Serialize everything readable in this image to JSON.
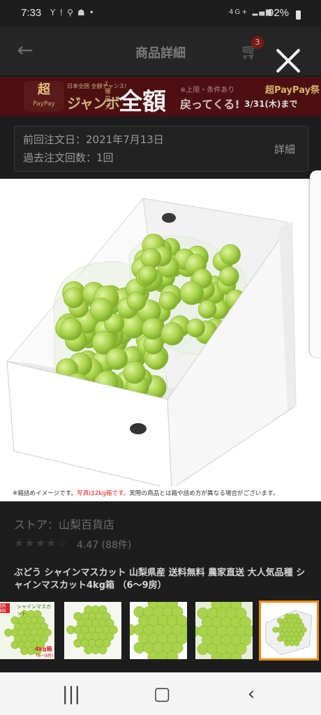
{
  "status_bar": {
    "time": "7:33",
    "battery": "92%",
    "network": "4G+"
  },
  "header": {
    "title": "商品詳細",
    "cart_count": "3"
  },
  "banner": {
    "tag": "超",
    "brand": "日本全国 全額チャンス!",
    "headline": "ジャンボ",
    "max_label": "1等最大",
    "amount": "全額",
    "note": "※上限・条件あり",
    "returns": "戻ってくる!",
    "festival": "超PayPay祭",
    "date": "3/31(木)まで"
  },
  "order_info": {
    "last_order": "前回注文日：2021年7月13日",
    "order_count": "過去注文回数：1回",
    "details_label": "詳細"
  },
  "image": {
    "caption_prefix": "※箱詰めイメージです。",
    "caption_red": "写真は2kg箱です。",
    "caption_suffix": "実際の商品とは箱や詰め方が異なる場合がございます。"
  },
  "store": {
    "label": "ストア：山梨百貨店",
    "stars": "★★★★☆",
    "rating": "4.47",
    "reviews": "(88件)"
  },
  "product": {
    "title": "ぶどう シャインマスカット 山梨県産 送料無料 農家直送 大人気品種 シャインマスカット4kg箱 （6〜9房）"
  },
  "thumbnails": [
    {
      "label": "4kg箱",
      "sub": "(6〜9房)",
      "badge": "送料無料",
      "top_text": "シャインマスカット"
    },
    {
      "label": ""
    },
    {
      "label": ""
    },
    {
      "label": ""
    },
    {
      "label": ""
    }
  ],
  "colors": {
    "grape_green": "#a9d34a",
    "selected_outline": "#e98a12",
    "banner_bg": "#4d0f12"
  }
}
